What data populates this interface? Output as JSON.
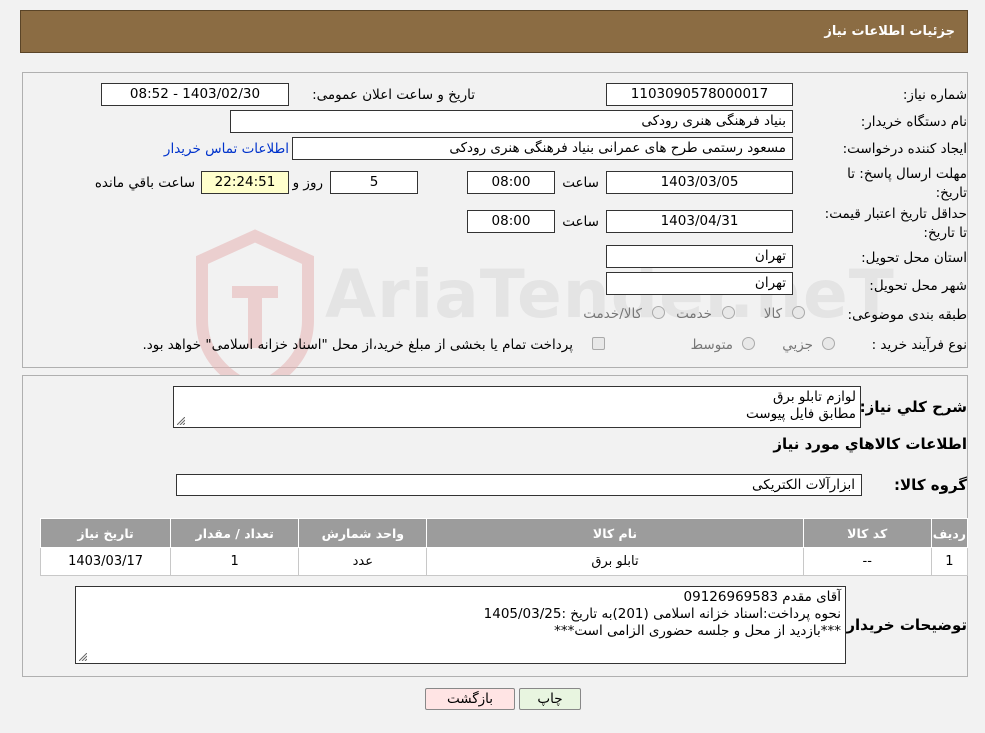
{
  "header": {
    "title": "جزئیات اطلاعات نیاز"
  },
  "watermark": {
    "text": "AriaTender.neT"
  },
  "form": {
    "need_number_label": "شماره نیاز:",
    "need_number": "1103090578000017",
    "announce_label": "تاریخ و ساعت اعلان عمومی:",
    "announce_value": "1403/02/30 - 08:52",
    "buyer_org_label": "نام دستگاه خریدار:",
    "buyer_org": "بنیاد فرهنگی هنری رودکی",
    "requester_label": "ایجاد کننده درخواست:",
    "requester": "مسعود رستمی طرح های عمرانی بنیاد فرهنگی هنری رودکی",
    "contact_link": "اطلاعات تماس خریدار",
    "deadline_label": "مهلت ارسال پاسخ: تا تاریخ:",
    "deadline_date": "1403/03/05",
    "time_label": "ساعت",
    "deadline_time": "08:00",
    "days_value": "5",
    "days_label": "روز و",
    "remaining_time": "22:24:51",
    "remaining_label": "ساعت باقي مانده",
    "validity_label": "حداقل تاریخ اعتبار قیمت: تا تاریخ:",
    "validity_date": "1403/04/31",
    "validity_time": "08:00",
    "province_label": "استان محل تحویل:",
    "province": "تهران",
    "city_label": "شهر محل تحویل:",
    "city": "تهران",
    "category_label": "طبقه بندی موضوعی:",
    "category_options": [
      "کالا",
      "خدمت",
      "کالا/خدمت"
    ],
    "process_label": "نوع فرآیند خرید :",
    "process_options": [
      "جزیي",
      "متوسط"
    ],
    "process_note": "پرداخت تمام یا بخشی از مبلغ خرید،از محل \"اسناد خزانه اسلامی\" خواهد بود."
  },
  "summary": {
    "label": "شرح کلي نياز:",
    "lines": [
      "لوازم تابلو برق",
      "مطابق فایل پیوست"
    ]
  },
  "goods": {
    "section_title": "اطلاعات کالاهاي مورد نياز",
    "group_label": "گروه کالا:",
    "group_value": "ابزارآلات الکتریکی",
    "columns": [
      "رديف",
      "کد کالا",
      "نام کالا",
      "واحد شمارش",
      "تعداد / مقدار",
      "تاريخ نياز"
    ],
    "rows": [
      {
        "row": "1",
        "code": "--",
        "name": "تابلو برق",
        "unit": "عدد",
        "qty": "1",
        "date": "1403/03/17"
      }
    ]
  },
  "buyer_notes": {
    "label": "توضيحات خريدار:",
    "lines": [
      "آقای مقدم 09126969583",
      "نحوه پرداخت:اسناد خزانه اسلامی (201)به تاریخ :1405/03/25",
      "***بازدید از محل و جلسه حضوری الزامی است***"
    ]
  },
  "buttons": {
    "print": "چاپ",
    "back": "بازگشت"
  },
  "colors": {
    "header_bg": "#8b6c43",
    "back_btn_bg": "#ffe4e4",
    "print_btn_bg": "#e8f5e0",
    "remaining_bg": "#ffffcc"
  }
}
